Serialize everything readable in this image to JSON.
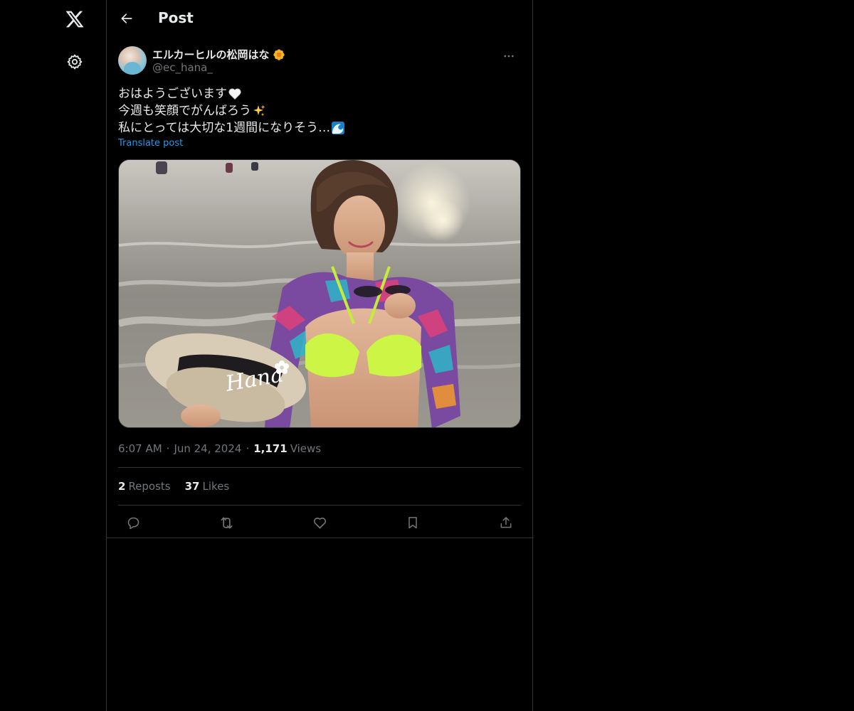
{
  "topbar": {
    "title": "Post"
  },
  "post": {
    "author": {
      "display_name": "エルカーヒルの松岡はな",
      "display_name_emoji": "blossom-emoji",
      "handle": "@ec_hana_"
    },
    "text_lines": [
      {
        "text": "おはようございます",
        "emoji": "white-heart-emoji"
      },
      {
        "text": "今週も笑顔でがんばろう",
        "emoji": "sparkles-emoji"
      },
      {
        "text": "私にとっては大切な1週間になりそう…",
        "emoji": "wave-emoji"
      }
    ],
    "translate_label": "Translate post",
    "media": {
      "watermark": "Hana"
    },
    "time": "6:07 AM",
    "date": "Jun 24, 2024",
    "views_count": "1,171",
    "views_label": "Views",
    "reposts_count": "2",
    "reposts_label": "Reposts",
    "likes_count": "37",
    "likes_label": "Likes"
  },
  "icons": {
    "logo": "x-logo-icon",
    "settings": "gear-icon",
    "back": "arrow-left-icon",
    "more": "more-horizontal-icon",
    "reply": "reply-icon",
    "repost": "repost-icon",
    "like": "heart-icon",
    "bookmark": "bookmark-icon",
    "share": "share-icon"
  },
  "colors": {
    "background": "#000000",
    "text": "#e7e9ea",
    "secondary_text": "#71767b",
    "link": "#1d9bf0",
    "border": "#2f3336"
  }
}
